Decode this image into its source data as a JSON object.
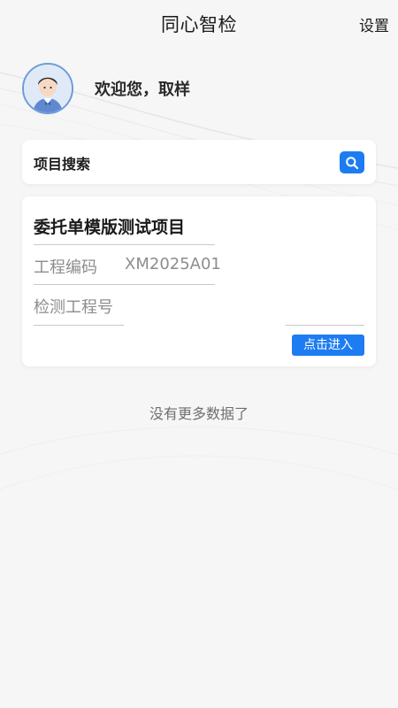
{
  "header": {
    "title": "同心智检",
    "settings_label": "设置"
  },
  "profile": {
    "welcome_text": "欢迎您，取样"
  },
  "search": {
    "label": "项目搜索",
    "icon": "search-icon"
  },
  "project": {
    "title": "委托单模版测试项目",
    "code_label": "工程编码",
    "code_value": "XM2025A01",
    "number_label": "检测工程号",
    "number_value": "",
    "enter_label": "点击进入"
  },
  "list": {
    "end_text": "没有更多数据了"
  },
  "colors": {
    "accent": "#1e7cf2",
    "background": "#f6f6f7",
    "card": "#ffffff"
  }
}
